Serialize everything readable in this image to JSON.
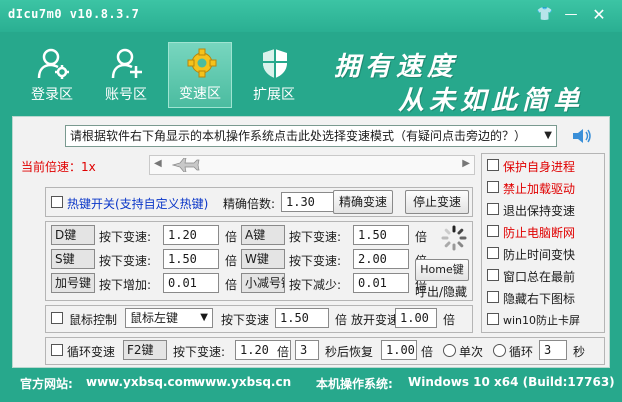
{
  "window": {
    "title": "dIcu7m0 v10.8.3.7"
  },
  "tabs": [
    {
      "label": "登录区",
      "icon": "login-icon"
    },
    {
      "label": "账号区",
      "icon": "account-icon"
    },
    {
      "label": "变速区",
      "icon": "gear-icon",
      "active": true
    },
    {
      "label": "扩展区",
      "icon": "shield-icon"
    }
  ],
  "slogan": {
    "line1": "拥有速度",
    "line2": "从未如此简单"
  },
  "mode_combo": {
    "value": "请根据软件右下角显示的本机操作系统点击此处选择变速模式（有疑问点击旁边的？）"
  },
  "speed": {
    "label": "当前倍速：",
    "value": "1x"
  },
  "hotkey": {
    "toggle_label": "热键开关(支持自定义热键)",
    "precise_label": "精确倍数:",
    "precise_value": "1.30",
    "precise_button": "精确变速",
    "stop_button": "停止变速"
  },
  "keys": {
    "press_label": "按下变速:",
    "unit": "倍",
    "d": {
      "key": "D键",
      "value": "1.20"
    },
    "a": {
      "key": "A键",
      "value": "1.50"
    },
    "s": {
      "key": "S键",
      "value": "1.50"
    },
    "w": {
      "key": "W键",
      "value": "2.00"
    },
    "plus": {
      "key": "加号键",
      "label": "按下增加:",
      "value": "0.01"
    },
    "minus": {
      "key": "小减号键",
      "label": "按下减少:",
      "value": "0.01"
    },
    "home_button": "Home键",
    "home_caption": "呼出/隐藏"
  },
  "mouse": {
    "label": "鼠标控制",
    "button": "鼠标左键",
    "press_label": "按下变速",
    "press_value": "1.50",
    "unit": "倍",
    "release_label": "放开变速",
    "release_value": "1.00"
  },
  "loop": {
    "label": "循环变速",
    "key": "F2键",
    "press_label": "按下变速:",
    "press_value": "1.20",
    "unit": "倍",
    "seconds": "3",
    "restore_label": "秒后恢复",
    "restore_value": "1.00",
    "once_label": "单次",
    "loop_label": "循环",
    "loop_value": "3",
    "sec_unit": "秒"
  },
  "options": [
    {
      "label": "保护自身进程",
      "color": "#e00000"
    },
    {
      "label": "禁止加载驱动",
      "color": "#e00000"
    },
    {
      "label": "退出保持变速",
      "color": "#1a1a1a"
    },
    {
      "label": "防止电脑断网",
      "color": "#e00000"
    },
    {
      "label": "防止时间变快",
      "color": "#1a1a1a"
    },
    {
      "label": "窗口总在最前",
      "color": "#1a1a1a"
    },
    {
      "label": "隐藏右下图标",
      "color": "#1a1a1a"
    },
    {
      "label": "win10防止卡屏",
      "color": "#1a1a1a"
    }
  ],
  "footer": {
    "site_label": "官方网站:",
    "site1": "www.yxbsq.com",
    "site2": "www.yxbsq.cn",
    "os_label": "本机操作系统:",
    "os_value": "Windows 10 x64 (Build:17763)"
  }
}
